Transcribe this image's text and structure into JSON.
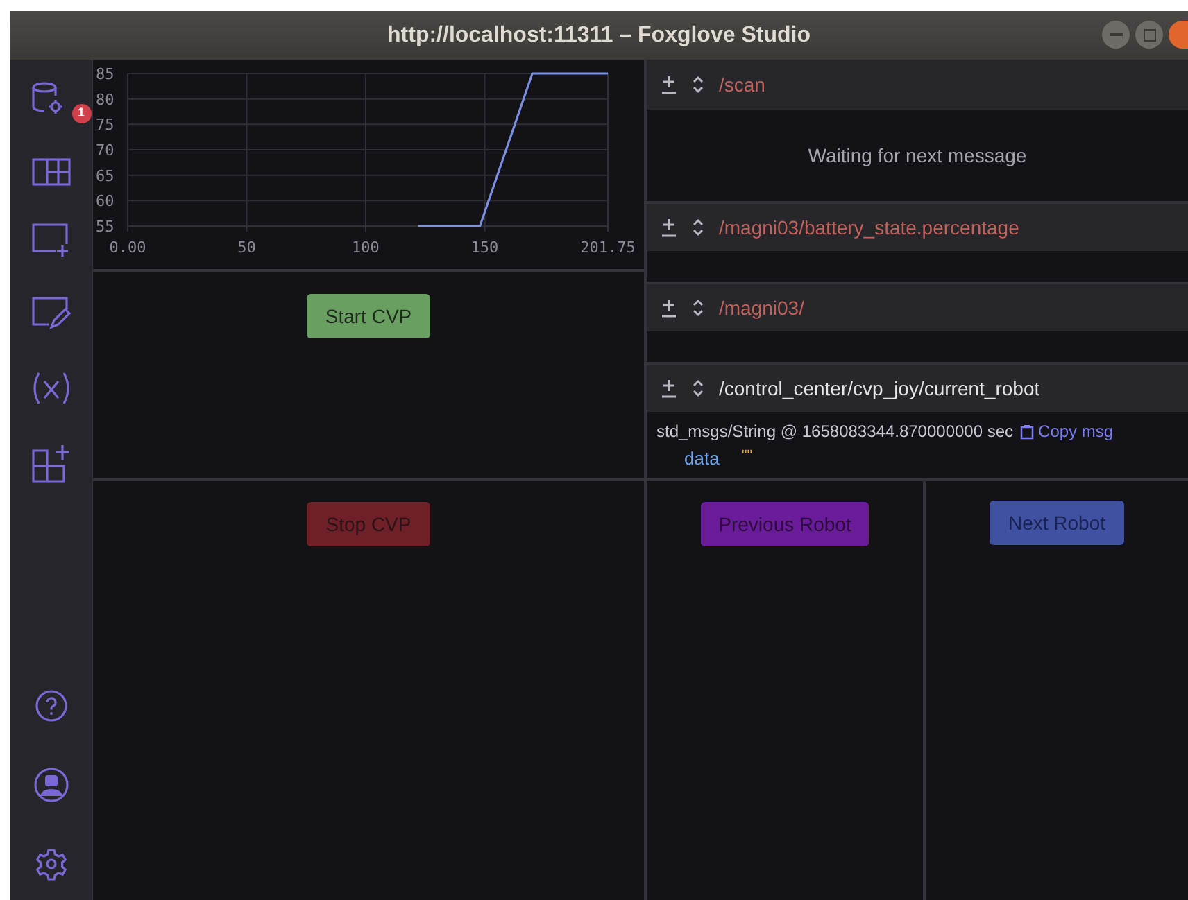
{
  "window": {
    "title": "http://localhost:11311 – Foxglove Studio"
  },
  "sidebar": {
    "top_items": [
      {
        "kind": "data-source",
        "badge": "1"
      },
      {
        "kind": "layout"
      },
      {
        "kind": "add-panel"
      },
      {
        "kind": "edit-panel"
      },
      {
        "kind": "variables"
      },
      {
        "kind": "extensions"
      }
    ],
    "bottom_items": [
      {
        "kind": "help"
      },
      {
        "kind": "account"
      },
      {
        "kind": "settings"
      }
    ]
  },
  "plot": {
    "chart_data": {
      "type": "line",
      "x": [
        122,
        148,
        170,
        201.75
      ],
      "series": [
        {
          "color": "#7b8fe0",
          "values": [
            55,
            55,
            85,
            85
          ]
        }
      ],
      "xlim": [
        0,
        201.75
      ],
      "ylim": [
        55,
        85
      ],
      "xticks": [
        {
          "value": 0,
          "label": "0.00"
        },
        50,
        100,
        150,
        {
          "value": 201.75,
          "label": "201.75"
        }
      ],
      "yticks": [
        55,
        60,
        65,
        70,
        75,
        80,
        85
      ],
      "grid": true
    }
  },
  "message_panels": [
    {
      "topic": "/scan",
      "valid": false,
      "body": {
        "kind": "status",
        "text": "Waiting for next message"
      }
    },
    {
      "topic": "/magni03/battery_state.percentage",
      "valid": false,
      "body": {
        "kind": "empty"
      }
    },
    {
      "topic": "/magni03/",
      "valid": false,
      "body": {
        "kind": "empty"
      }
    },
    {
      "topic": "/control_center/cvp_joy/current_robot",
      "valid": true,
      "body": {
        "kind": "message",
        "meta": "std_msgs/String @ 1658083344.870000000 sec",
        "copy_label": "Copy msg",
        "fields": [
          {
            "key": "data",
            "value": "\"\""
          }
        ]
      }
    }
  ],
  "buttons": [
    {
      "label": "Start CVP",
      "color": "#6a9f62"
    },
    {
      "label": "Stop CVP",
      "color": "#6e1f27"
    },
    {
      "label": "Previous Robot",
      "color": "#6a1b9a"
    },
    {
      "label": "Next Robot",
      "color": "#3f51a0"
    }
  ]
}
